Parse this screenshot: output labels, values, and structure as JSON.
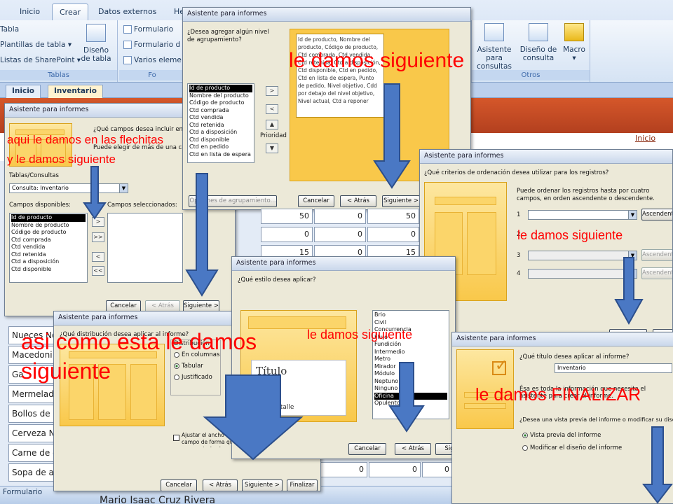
{
  "ribbon": {
    "tabs": [
      "Inicio",
      "Crear",
      "Datos externos",
      "He"
    ],
    "active_tab": "Crear",
    "tables_group": {
      "items": [
        "Tabla",
        "Plantillas de tabla",
        "Listas de SharePoint"
      ],
      "big_button": "Diseño de tabla",
      "label": "Tablas"
    },
    "forms_group": {
      "items": [
        "Formulario",
        "Formulario d",
        "Varios eleme"
      ],
      "label": "Fo"
    },
    "other_group": {
      "wizard_btn": "Asistente para consultas",
      "design_btn": "Diseño de consulta",
      "macro_btn": "Macro",
      "label": "Otros"
    }
  },
  "doc_tabs": [
    "Inicio",
    "Inventario"
  ],
  "form_header_link": "Inicio",
  "datasheet": {
    "rows_numeric": [
      [
        "50",
        "0",
        "50"
      ],
      [
        "0",
        "0",
        "0"
      ],
      [
        "15",
        "0",
        "15"
      ]
    ],
    "row_numeric_bottom": [
      "0",
      "0",
      "0"
    ],
    "names": [
      "Nueces No",
      "Macedoni",
      "Ga",
      "Mermelad",
      "Bollos de p",
      "Cerveza N",
      "Carne de c",
      "Sopa de al"
    ]
  },
  "status_bar": "Formulario",
  "footer_name": "Mario Isaac Cruz Rivera",
  "wizard1": {
    "title": "Asistente para informes",
    "question": "¿Qué campos desea incluir en el informe?",
    "subtext": "Puede elegir de más de una consulta o tabla.",
    "tables_label": "Tablas/Consultas",
    "tables_value": "Consulta: Inventario",
    "available_label": "Campos disponibles:",
    "selected_label": "Campos seleccionados:",
    "available": [
      "Id de producto",
      "Nombre de producto",
      "Código de producto",
      "Ctd comprada",
      "Ctd vendida",
      "Ctd retenida",
      "Ctd a disposición",
      "Ctd disponible"
    ],
    "buttons": [
      "Cancelar",
      "< Atrás",
      "Siguiente >"
    ],
    "move_buttons": [
      ">",
      ">>",
      "<",
      "<<"
    ]
  },
  "wizard2": {
    "title": "Asistente para informes",
    "question": "¿Desea agregar algún nivel de agrupamiento?",
    "fields": [
      "Id de producto",
      "Nombre del producto",
      "Código de producto",
      "Ctd comprada",
      "Ctd vendida",
      "Ctd retenida",
      "Ctd a disposición",
      "Ctd disponible",
      "Ctd en pedido",
      "Ctd en lista de espera"
    ],
    "preview_text": "Id de producto, Nombre del producto, Código de producto, Ctd comprada, Ctd vendida, Ctd retenida, Ctd a disposición, Ctd disponible, Ctd en pedido, Ctd en lista de espera, Punto de pedido, Nivel objetivo, Cdd por debajo del nivel objetivo, Nivel actual, Ctd a reponer",
    "priority_label": "Prioridad",
    "group_options_btn": "Opciones de agrupamiento...",
    "buttons": [
      "Cancelar",
      "< Atrás",
      "Siguiente >"
    ]
  },
  "wizard3": {
    "title": "Asistente para informes",
    "question": "¿Qué criterios de ordenación desea utilizar para los registros?",
    "subtext": "Puede ordenar los registros hasta por cuatro campos, en orden ascendente o descendente.",
    "row_numbers": [
      "1",
      "2",
      "3",
      "4"
    ],
    "asc_label": "Ascendente"
  },
  "wizard4": {
    "title": "Asistente para informes",
    "question": "¿Qué distribución desea aplicar al informe?",
    "dist_label": "Distribución",
    "options": [
      "En columnas",
      "Tabular",
      "Justificado"
    ],
    "checkbox_text": "Ajustar el ancho del campo de forma que quepan todos los campos en una página.",
    "buttons": [
      "Cancelar",
      "< Atrás",
      "Siguiente >",
      "Finalizar"
    ]
  },
  "wizard5": {
    "title": "Asistente para informes",
    "question": "¿Qué estilo desea aplicar?",
    "preview_title": "Título",
    "preview_label": "e Detalle",
    "styles": [
      "Brio",
      "Civil",
      "Concurrencia",
      "Flujo",
      "Fundición",
      "Intermedio",
      "Metro",
      "Mirador",
      "Módulo",
      "Neptuno",
      "Ninguno",
      "Oficina",
      "Opulento"
    ],
    "selected_style": "Oficina",
    "buttons": [
      "Cancelar",
      "< Atrás",
      "Sig"
    ]
  },
  "wizard6": {
    "title": "Asistente para informes",
    "question": "¿Qué título desea aplicar al informe?",
    "title_value": "Inventario",
    "info_text": "Ésa es toda la información que necesita el asistente para crear el informe.",
    "preview_question": "¿Desea una vista previa del informe o modificar su diseño?",
    "options": [
      "Vista previa del informe",
      "Modificar el diseño del informe"
    ]
  },
  "annotations": {
    "a1": "aqui le damos en las flechitas",
    "a2": "y le damos siguiente",
    "a3": "le damos siguiente",
    "a4": "le damos siguiente",
    "a5": "asi como esta le damos",
    "a6": "siguiente",
    "a7": "le damos siguiente",
    "a8": "le damos FINALIZAR"
  },
  "colors": {
    "annotation": "#ff0000",
    "arrow": "#4a78c4",
    "preview_yellow": "#f9c84a",
    "form_header": "#c04a24"
  }
}
